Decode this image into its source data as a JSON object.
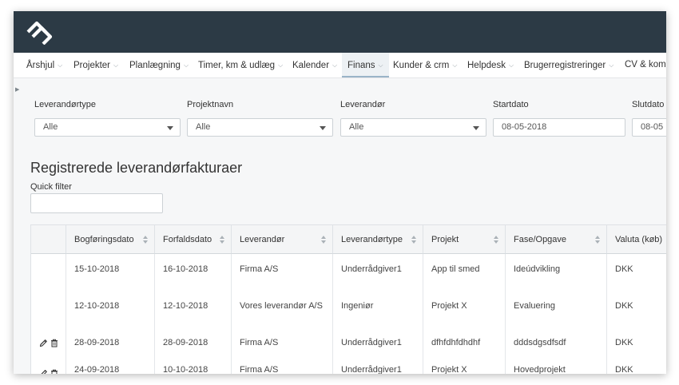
{
  "nav": {
    "items": [
      {
        "label": "Årshjul"
      },
      {
        "label": "Projekter"
      },
      {
        "label": "Planlægning"
      },
      {
        "label": "Timer, km & udlæg"
      },
      {
        "label": "Kalender"
      },
      {
        "label": "Finans",
        "active": true
      },
      {
        "label": "Kunder & crm"
      },
      {
        "label": "Helpdesk"
      },
      {
        "label": "Brugerregistreringer"
      },
      {
        "label": "CV & komp"
      }
    ]
  },
  "filters": {
    "supplier_type": {
      "label": "Leverandørtype",
      "value": "Alle"
    },
    "project_name": {
      "label": "Projektnavn",
      "value": "Alle"
    },
    "supplier": {
      "label": "Leverandør",
      "value": "Alle"
    },
    "start_date": {
      "label": "Startdato",
      "value": "08-05-2018"
    },
    "end_date": {
      "label": "Slutdato",
      "value": "08-05"
    }
  },
  "page": {
    "title": "Registrerede leverandørfakturaer",
    "quick_filter_label": "Quick filter",
    "quick_filter_value": ""
  },
  "table": {
    "columns": [
      "Bogføringsdato",
      "Forfaldsdato",
      "Leverandør",
      "Leverandørtype",
      "Projekt",
      "Fase/Opgave",
      "Valuta (køb)"
    ],
    "rows": [
      {
        "actions": false,
        "cells": [
          "15-10-2018",
          "16-10-2018",
          "Firma A/S",
          "Underrådgiver1",
          "App til smed",
          "Ideúdvikling",
          "DKK"
        ]
      },
      {
        "actions": false,
        "cells": [
          "12-10-2018",
          "12-10-2018",
          "Vores leverandør A/S",
          "Ingeniør",
          "Projekt X",
          "Evaluering",
          "DKK"
        ]
      },
      {
        "actions": true,
        "cells": [
          "28-09-2018",
          "28-09-2018",
          "Firma A/S",
          "Underrådgiver1",
          "dfhfdhfdhdhf",
          "dddsdgsdfsdf",
          "DKK"
        ]
      },
      {
        "actions": true,
        "cells": [
          "24-09-2018",
          "10-10-2018",
          "Firma A/S",
          "Underrådgiver1",
          "Projekt X",
          "Hovedprojekt",
          "DKK"
        ]
      }
    ]
  },
  "icons": {
    "edit": "pencil-icon",
    "delete": "trash-icon",
    "logo": "logo-icon",
    "chevron": "chevron-down-icon"
  },
  "colors": {
    "topbar": "#2c3a45",
    "active_tab_bg": "#edf1f4",
    "active_tab_border": "#9ab4c8"
  }
}
